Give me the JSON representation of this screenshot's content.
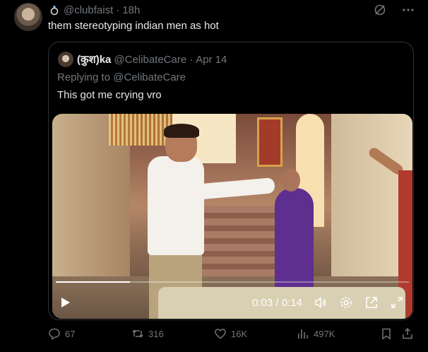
{
  "post": {
    "handle": "@clubfaist",
    "separator": "·",
    "time": "18h",
    "text": "them stereotyping indian men as hot"
  },
  "quote": {
    "name": "(कुश)ka",
    "handle": "@CelibateCare",
    "separator": "·",
    "date": "Apr 14",
    "replying_prefix": "Replying to",
    "replying_to": "@CelibateCare",
    "text": "This got me crying vro"
  },
  "video": {
    "time_display": "0:03 / 0:14",
    "progress_fraction": 0.21
  },
  "actions": {
    "replies": "67",
    "reposts": "316",
    "likes": "16K",
    "views": "497K"
  },
  "colors": {
    "background": "#000000",
    "text_primary": "#e7e9ea",
    "text_secondary": "#71767b",
    "border": "#2f3336"
  },
  "icons": [
    "ring-icon",
    "mute-conversation-icon",
    "more-icon",
    "play-icon",
    "volume-icon",
    "settings-icon",
    "popout-icon",
    "fullscreen-icon",
    "reply-icon",
    "repost-icon",
    "like-icon",
    "views-icon",
    "bookmark-icon",
    "share-icon"
  ]
}
